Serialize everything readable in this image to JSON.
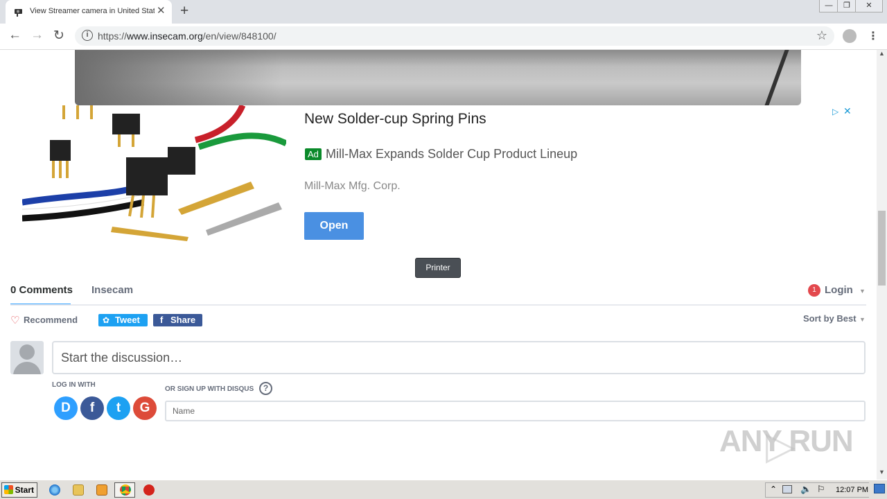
{
  "browser": {
    "tab_title": "View Streamer camera in United States",
    "tab_close": "✕",
    "new_tab": "+",
    "url_scheme": "https://",
    "url_host": "www.insecam.org",
    "url_path": "/en/view/848100/",
    "window_controls": {
      "minimize": "—",
      "maximize": "❐",
      "close": "✕"
    }
  },
  "ad": {
    "title": "New Solder-cup Spring Pins",
    "badge": "Ad",
    "description": "Mill-Max Expands Solder Cup Product Lineup",
    "advertiser": "Mill-Max Mfg. Corp.",
    "cta": "Open"
  },
  "printer_button": "Printer",
  "disqus": {
    "tab_comments": "0 Comments",
    "tab_community": "Insecam",
    "notification_count": "1",
    "login": "Login",
    "recommend": "Recommend",
    "tweet": "Tweet",
    "share": "Share",
    "sort": "Sort by Best",
    "discussion_placeholder": "Start the discussion…",
    "login_with": "LOG IN WITH",
    "signup_with": "OR SIGN UP WITH DISQUS",
    "help": "?",
    "name_placeholder": "Name",
    "social": [
      {
        "letter": "D",
        "color": "#2e9fff",
        "name": "disqus-login-icon"
      },
      {
        "letter": "f",
        "color": "#3b5998",
        "name": "facebook-login-icon"
      },
      {
        "letter": "t",
        "color": "#1da1f2",
        "name": "twitter-login-icon"
      },
      {
        "letter": "G",
        "color": "#dd4b39",
        "name": "google-login-icon"
      }
    ]
  },
  "watermark": "ANY  RUN",
  "taskbar": {
    "start": "Start",
    "clock": "12:07 PM"
  }
}
